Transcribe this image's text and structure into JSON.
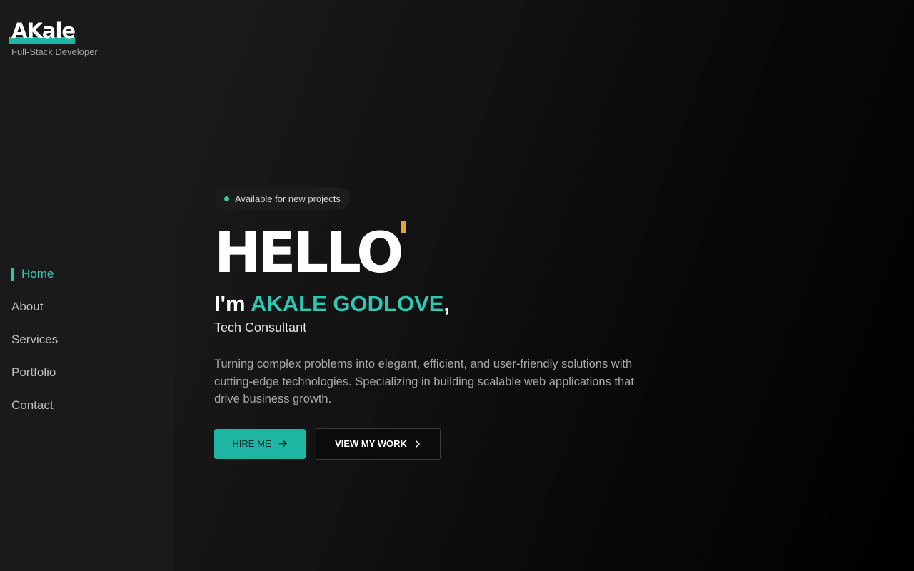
{
  "brand": {
    "logo": "AKale",
    "subtitle": "Full-Stack Developer",
    "accent_color": "#1fb5a3"
  },
  "nav": {
    "items": [
      {
        "label": "Home",
        "active": true
      },
      {
        "label": "About",
        "active": false
      },
      {
        "label": "Services",
        "active": false
      },
      {
        "label": "Portfolio",
        "active": false
      },
      {
        "label": "Contact",
        "active": false
      }
    ]
  },
  "hero": {
    "badge": "Available for new projects",
    "greeting": "HELLO",
    "intro_prefix": "I'm ",
    "name": "AKALE GODLOVE",
    "intro_suffix": ",",
    "role": "Tech Consultant",
    "description": "Turning complex problems into elegant, efficient, and user-friendly solutions with cutting-edge technologies. Specializing in building scalable web applications that drive business growth.",
    "cursor_color": "#e3a532"
  },
  "actions": {
    "primary_label": "HIRE ME",
    "primary_icon": "arrow-right-icon",
    "secondary_label": "VIEW MY WORK",
    "secondary_icon": "chevron-right-icon"
  }
}
